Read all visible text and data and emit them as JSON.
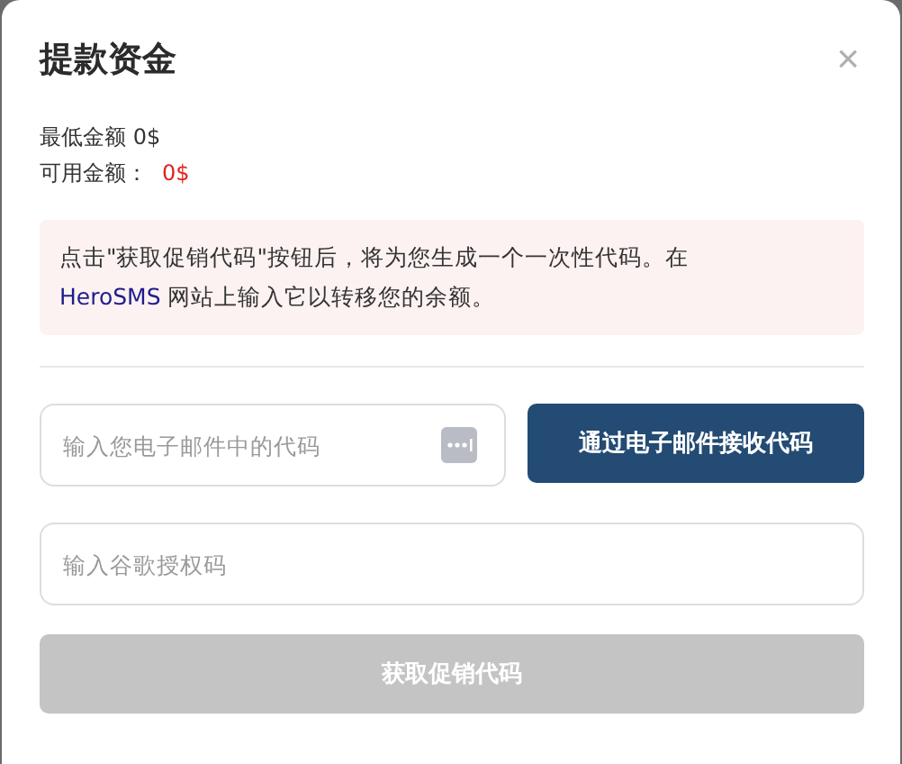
{
  "dialog": {
    "title": "提款资金",
    "close": "×"
  },
  "min_amount": "最低金额 0$",
  "available": {
    "label": "可用金额：",
    "value": "0$"
  },
  "notice": {
    "before": "点击\"获取促销代码\"按钮后，将为您生成一个一次性代码。在 ",
    "link": "HeroSMS",
    "after": " 网站上输入它以转移您的余额。"
  },
  "email_code": {
    "placeholder": "输入您电子邮件中的代码"
  },
  "email_button": {
    "label": "通过电子邮件接收代码",
    "disabled": false
  },
  "google_code": {
    "placeholder": "输入谷歌授权码"
  },
  "submit_button": {
    "label": "获取促销代码",
    "disabled": true
  }
}
